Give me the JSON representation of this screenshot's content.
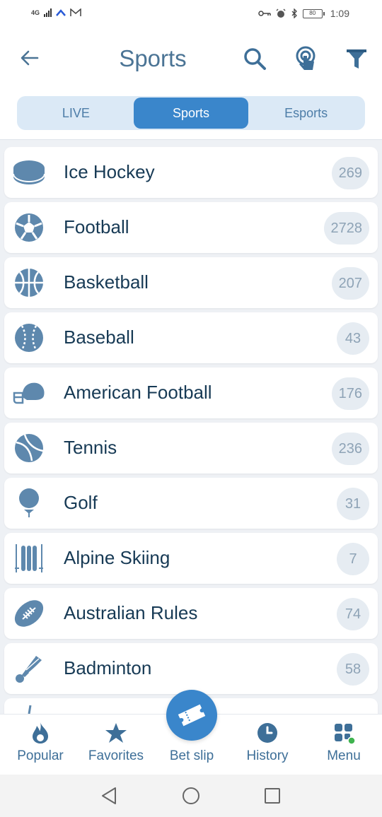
{
  "status_bar": {
    "network": "4G",
    "time": "1:09",
    "battery": "80"
  },
  "header": {
    "title": "Sports"
  },
  "tabs": [
    {
      "label": "LIVE",
      "active": false
    },
    {
      "label": "Sports",
      "active": true
    },
    {
      "label": "Esports",
      "active": false
    }
  ],
  "sports": [
    {
      "name": "Ice Hockey",
      "count": "269",
      "icon": "puck-icon"
    },
    {
      "name": "Football",
      "count": "2728",
      "icon": "soccer-ball-icon"
    },
    {
      "name": "Basketball",
      "count": "207",
      "icon": "basketball-icon"
    },
    {
      "name": "Baseball",
      "count": "43",
      "icon": "baseball-icon"
    },
    {
      "name": "American Football",
      "count": "176",
      "icon": "helmet-icon"
    },
    {
      "name": "Tennis",
      "count": "236",
      "icon": "tennis-ball-icon"
    },
    {
      "name": "Golf",
      "count": "31",
      "icon": "golf-ball-icon"
    },
    {
      "name": "Alpine Skiing",
      "count": "7",
      "icon": "skis-icon"
    },
    {
      "name": "Australian Rules",
      "count": "74",
      "icon": "rugby-ball-icon"
    },
    {
      "name": "Badminton",
      "count": "58",
      "icon": "shuttlecock-icon"
    }
  ],
  "bottom_nav": {
    "popular": "Popular",
    "favorites": "Favorites",
    "bet_slip": "Bet slip",
    "history": "History",
    "menu": "Menu"
  },
  "colors": {
    "accent": "#3a86cb",
    "icon": "#5e88ad",
    "text": "#173a55",
    "badge_bg": "#e6ecf2",
    "menu_dot": "#3fb34f"
  }
}
